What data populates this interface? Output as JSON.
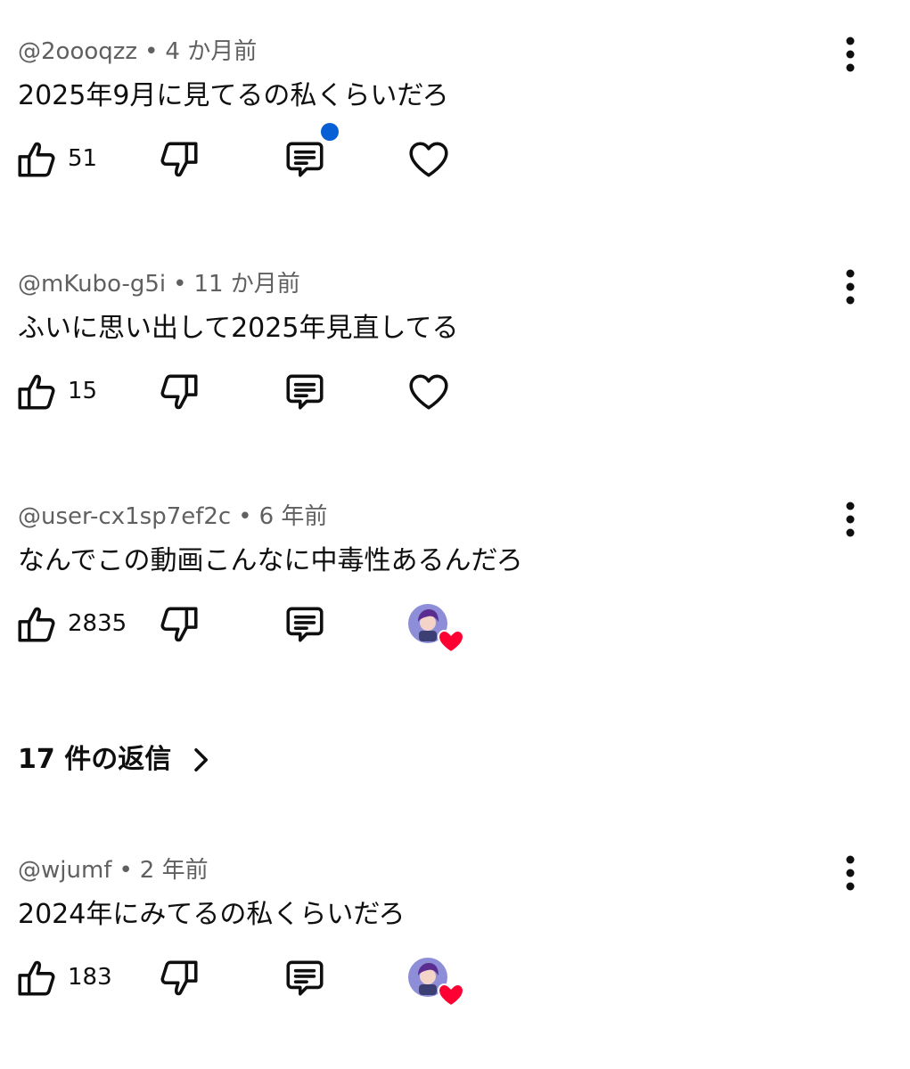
{
  "comments": [
    {
      "author": "@2oooqzz",
      "time": "4 か月前",
      "text": "2025年9月に見てるの私くらいだろ",
      "likes": "51",
      "hearted": false,
      "creator_heart": false,
      "notification": true
    },
    {
      "author": "@mKubo-g5i",
      "time": "11 か月前",
      "text": "ふいに思い出して2025年見直してる",
      "likes": "15",
      "hearted": false,
      "creator_heart": false,
      "notification": false
    },
    {
      "author": "@user-cx1sp7ef2c",
      "time": "6 年前",
      "text": "なんでこの動画こんなに中毒性あるんだろ",
      "likes": "2835",
      "hearted": true,
      "creator_heart": true,
      "notification": false,
      "replies": "17 件の返信"
    },
    {
      "author": "@wjumf",
      "time": "2 年前",
      "text": "2024年にみてるの私くらいだろ",
      "likes": "183",
      "hearted": true,
      "creator_heart": true,
      "notification": false
    }
  ],
  "meta_separator": "•",
  "icons": {
    "like": "thumbs-up-icon",
    "dislike": "thumbs-down-icon",
    "reply": "comment-icon",
    "heart": "heart-icon",
    "more": "more-vert-icon",
    "chevron": "chevron-right-icon"
  },
  "colors": {
    "notification_dot": "#065fd4",
    "creator_heart": "#ff0033",
    "meta_text": "#606060"
  }
}
